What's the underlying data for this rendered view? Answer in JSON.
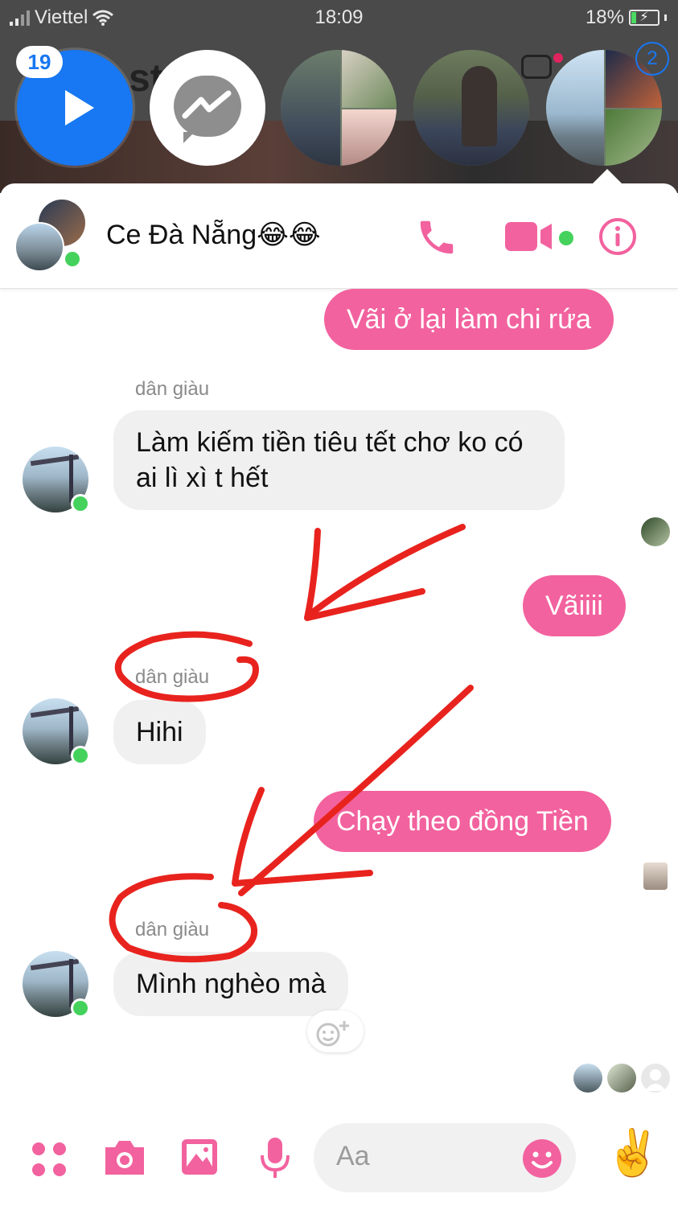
{
  "status": {
    "carrier": "Viettel",
    "time": "18:09",
    "battery": "18%"
  },
  "heads": {
    "badge_count": "19",
    "badge_other": "2"
  },
  "chat": {
    "title": "Ce Đà Nẵng😂😂"
  },
  "messages": [
    {
      "id": "m1",
      "direction": "out",
      "text": "Vãi ở lại làm chi rứa"
    },
    {
      "id": "m2",
      "direction": "in",
      "sender": "dân giàu",
      "text": "Làm kiếm tiền tiêu tết chơ ko có ai lì xì t hết"
    },
    {
      "id": "m3",
      "direction": "out",
      "text": "Vãiiii"
    },
    {
      "id": "m4",
      "direction": "in",
      "sender": "dân giàu",
      "text": "Hihi"
    },
    {
      "id": "m5",
      "direction": "out",
      "text": "Chạy theo đồng Tiền"
    },
    {
      "id": "m6",
      "direction": "in",
      "sender": "dân giàu",
      "text": "Mình nghèo mà"
    }
  ],
  "composer": {
    "placeholder": "Aa",
    "thumb_emoji": "✌️"
  },
  "icons": {
    "apps": "apps-icon",
    "camera": "camera-icon",
    "gallery": "gallery-icon",
    "mic": "microphone-icon",
    "emoji": "emoji-icon",
    "call": "phone-icon",
    "video": "video-icon",
    "info": "info-icon"
  },
  "colors": {
    "accent": "#f2629e",
    "online": "#44d25c",
    "messenger_blue": "#1877f2",
    "annotation": "#e8231e"
  }
}
